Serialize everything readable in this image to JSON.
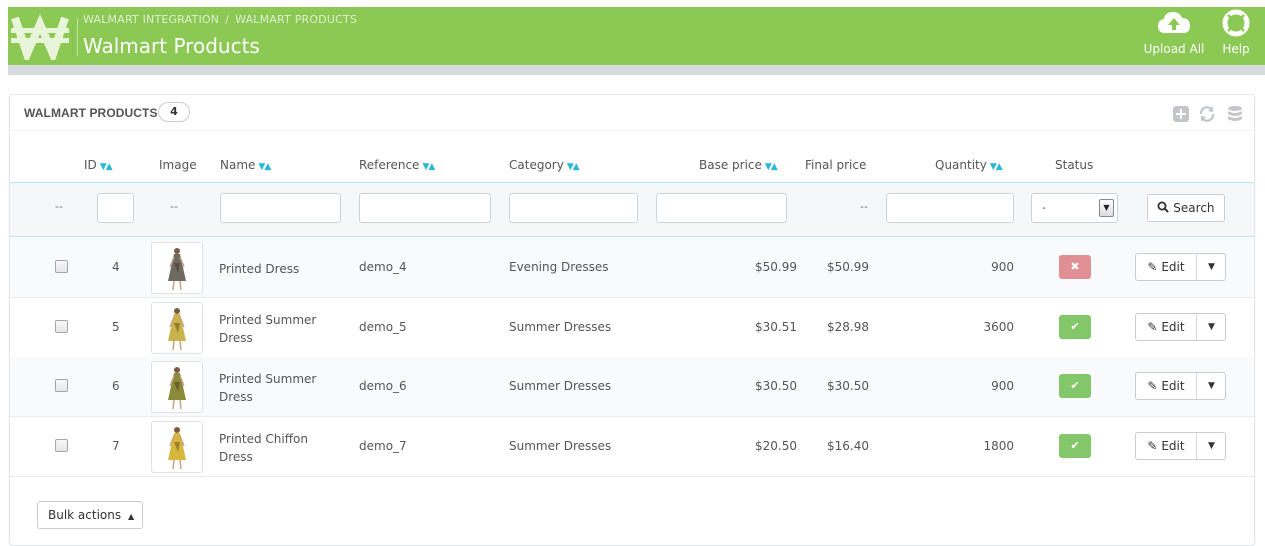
{
  "header": {
    "breadcrumb": [
      "WALMART INTEGRATION",
      "WALMART PRODUCTS"
    ],
    "breadcrumb_separator": "/",
    "title": "Walmart Products",
    "upload_all_label": "Upload All",
    "help_label": "Help",
    "bg_color": "#8bc954"
  },
  "panel": {
    "title": "WALMART PRODUCTS",
    "count": "4",
    "tools": [
      "add-icon",
      "refresh-icon",
      "database-icon"
    ]
  },
  "table": {
    "columns": {
      "id": "ID",
      "image": "Image",
      "name": "Name",
      "reference": "Reference",
      "category": "Category",
      "base_price": "Base price",
      "final_price": "Final price",
      "quantity": "Quantity",
      "status": "Status"
    },
    "filters": {
      "dash": "--",
      "status_selected": "-",
      "search_label": "Search"
    },
    "rows": [
      {
        "id": "4",
        "name": [
          "Printed Dress"
        ],
        "reference": "demo_4",
        "category": "Evening Dresses",
        "base_price": "$50.99",
        "final_price": "$50.99",
        "quantity": "900",
        "status": "off"
      },
      {
        "id": "5",
        "name": [
          "Printed Summer",
          "Dress"
        ],
        "reference": "demo_5",
        "category": "Summer Dresses",
        "base_price": "$30.51",
        "final_price": "$28.98",
        "quantity": "3600",
        "status": "on"
      },
      {
        "id": "6",
        "name": [
          "Printed Summer",
          "Dress"
        ],
        "reference": "demo_6",
        "category": "Summer Dresses",
        "base_price": "$30.50",
        "final_price": "$30.50",
        "quantity": "900",
        "status": "on"
      },
      {
        "id": "7",
        "name": [
          "Printed Chiffon",
          "Dress"
        ],
        "reference": "demo_7",
        "category": "Summer Dresses",
        "base_price": "$20.50",
        "final_price": "$16.40",
        "quantity": "1800",
        "status": "on"
      }
    ],
    "edit_label": "Edit"
  },
  "bulk_actions_label": "Bulk actions",
  "colors": {
    "accent": "#25b9d7",
    "status_enabled": "#84c76a",
    "status_disabled": "#e08f95"
  }
}
